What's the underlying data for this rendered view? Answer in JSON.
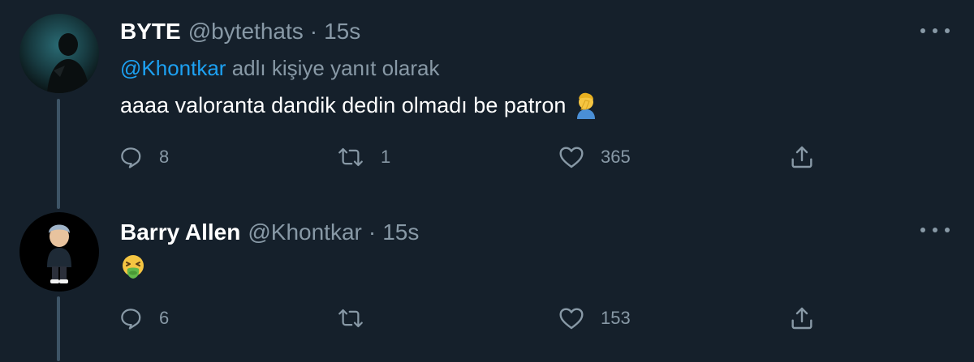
{
  "tweets": [
    {
      "display_name": "BYTE",
      "handle": "@bytethats",
      "separator": "·",
      "time": "15s",
      "reply_to_mention": "@Khontkar",
      "reply_to_suffix": " adlı kişiye yanıt olarak",
      "text": "aaaa valoranta dandik dedin olmadı be patron",
      "emoji": "🤦‍♂️",
      "replies": "8",
      "retweets": "1",
      "likes": "365"
    },
    {
      "display_name": "Barry Allen",
      "handle": "@Khontkar",
      "separator": "·",
      "time": "15s",
      "text": "",
      "emoji": "🤮",
      "replies": "6",
      "retweets": "",
      "likes": "153"
    }
  ],
  "colors": {
    "background": "#15202b",
    "secondary_text": "#8899a6",
    "accent": "#1da1f2",
    "thread_line": "#3d5466"
  },
  "icons": {
    "reply": "reply-icon",
    "retweet": "retweet-icon",
    "like": "heart-icon",
    "share": "share-icon",
    "more": "more-icon"
  }
}
